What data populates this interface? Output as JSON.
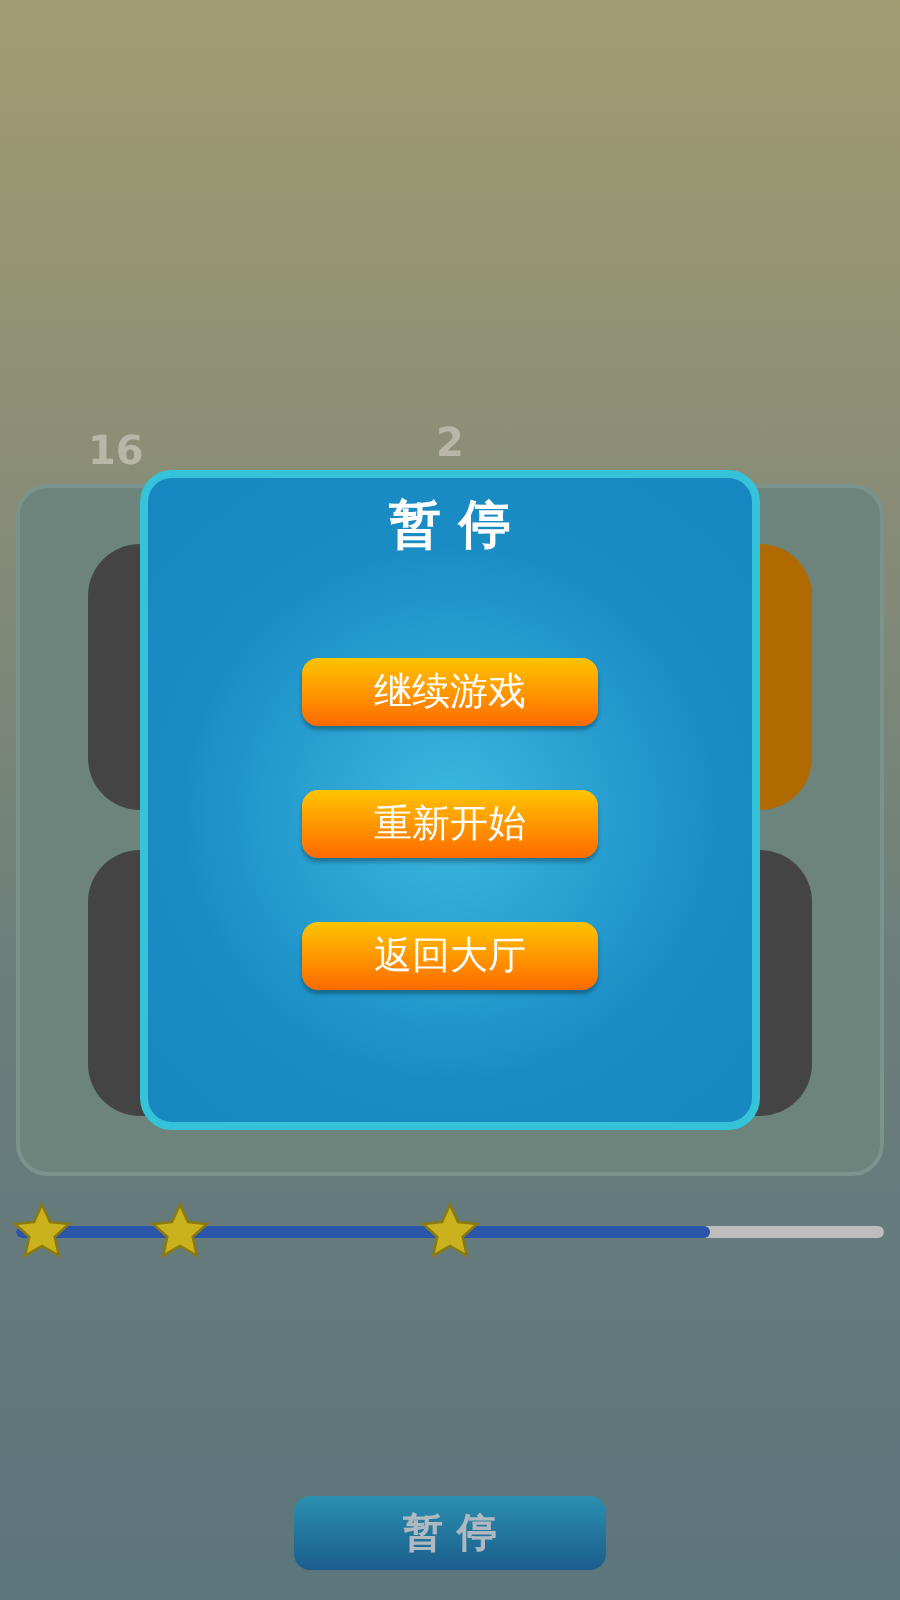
{
  "scores": [
    {
      "text": "16"
    },
    {
      "text": "2"
    }
  ],
  "board": {
    "tiles": [
      {
        "color": "#444444"
      },
      {
        "color": "#b06a00"
      },
      {
        "color": "#444444"
      },
      {
        "color": "#444444"
      }
    ]
  },
  "dialog": {
    "title": "暂 停",
    "buttons": [
      "继续游戏",
      "重新开始",
      "返回大厅"
    ]
  },
  "progress": {
    "level": 0.8,
    "milestones": [
      {
        "reached": true
      },
      {
        "reached": true
      },
      {
        "reached": true
      }
    ]
  },
  "pause_button": "暂 停"
}
